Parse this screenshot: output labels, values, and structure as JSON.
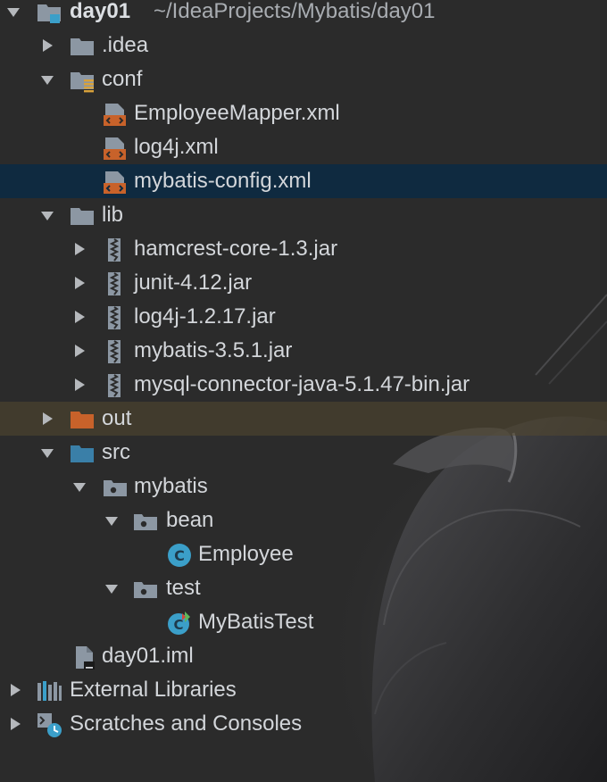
{
  "project": {
    "name": "day01",
    "path": "~/IdeaProjects/Mybatis/day01"
  },
  "items": [
    {
      "label": "day01",
      "icon": "project-folder-icon"
    },
    {
      "label": ".idea",
      "icon": "folder-icon"
    },
    {
      "label": "conf",
      "icon": "resources-folder-icon"
    },
    {
      "label": "EmployeeMapper.xml",
      "icon": "xml-file-icon"
    },
    {
      "label": "log4j.xml",
      "icon": "xml-file-icon"
    },
    {
      "label": "mybatis-config.xml",
      "icon": "xml-file-icon"
    },
    {
      "label": "lib",
      "icon": "folder-icon"
    },
    {
      "label": "hamcrest-core-1.3.jar",
      "icon": "jar-icon"
    },
    {
      "label": "junit-4.12.jar",
      "icon": "jar-icon"
    },
    {
      "label": "log4j-1.2.17.jar",
      "icon": "jar-icon"
    },
    {
      "label": "mybatis-3.5.1.jar",
      "icon": "jar-icon"
    },
    {
      "label": "mysql-connector-java-5.1.47-bin.jar",
      "icon": "jar-icon"
    },
    {
      "label": "out",
      "icon": "excluded-folder-icon"
    },
    {
      "label": "src",
      "icon": "source-folder-icon"
    },
    {
      "label": "mybatis",
      "icon": "package-icon"
    },
    {
      "label": "bean",
      "icon": "package-icon"
    },
    {
      "label": "Employee",
      "icon": "class-icon"
    },
    {
      "label": "test",
      "icon": "package-icon"
    },
    {
      "label": "MyBatisTest",
      "icon": "test-class-icon"
    },
    {
      "label": "day01.iml",
      "icon": "iml-file-icon"
    },
    {
      "label": "External Libraries",
      "icon": "libraries-icon"
    },
    {
      "label": "Scratches and Consoles",
      "icon": "scratches-icon"
    }
  ],
  "colors": {
    "background": "#2b2b2b",
    "selection": "#0f2a40",
    "highlight": "#544930",
    "text": "#d3d6da",
    "folder": "#8c97a3",
    "source_folder": "#3a7fa8",
    "excluded_folder": "#c8622a",
    "xml_accent": "#c8622a",
    "class_icon": "#3b9fc9"
  }
}
